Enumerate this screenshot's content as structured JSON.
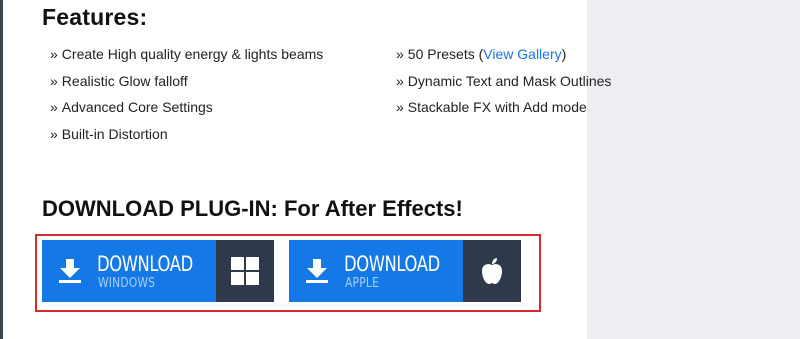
{
  "features": {
    "heading": "Features:",
    "bullet": "»",
    "left_items": [
      "Create High quality energy & lights beams",
      "Realistic Glow falloff",
      "Advanced Core Settings",
      "Built-in Distortion"
    ],
    "right_items": {
      "presets_prefix": "50 Presets (",
      "presets_link": "View Gallery",
      "presets_suffix": ")",
      "dynamic_text": "Dynamic Text and Mask Outlines",
      "stackable": "Stackable FX with Add mode"
    }
  },
  "download": {
    "heading": "DOWNLOAD PLUG-IN: For After Effects!",
    "windows": {
      "title": "DOWNLOAD",
      "subtitle": "WINDOWS",
      "icon": "windows-logo-icon"
    },
    "apple": {
      "title": "DOWNLOAD",
      "subtitle": "APPLE",
      "icon": "apple-logo-icon"
    }
  },
  "colors": {
    "button_blue": "#1478e6",
    "os_panel": "#2e3a4c",
    "highlight_border": "#d62b2b",
    "link": "#1a73e8",
    "sidebar_bg": "#eceef2"
  }
}
